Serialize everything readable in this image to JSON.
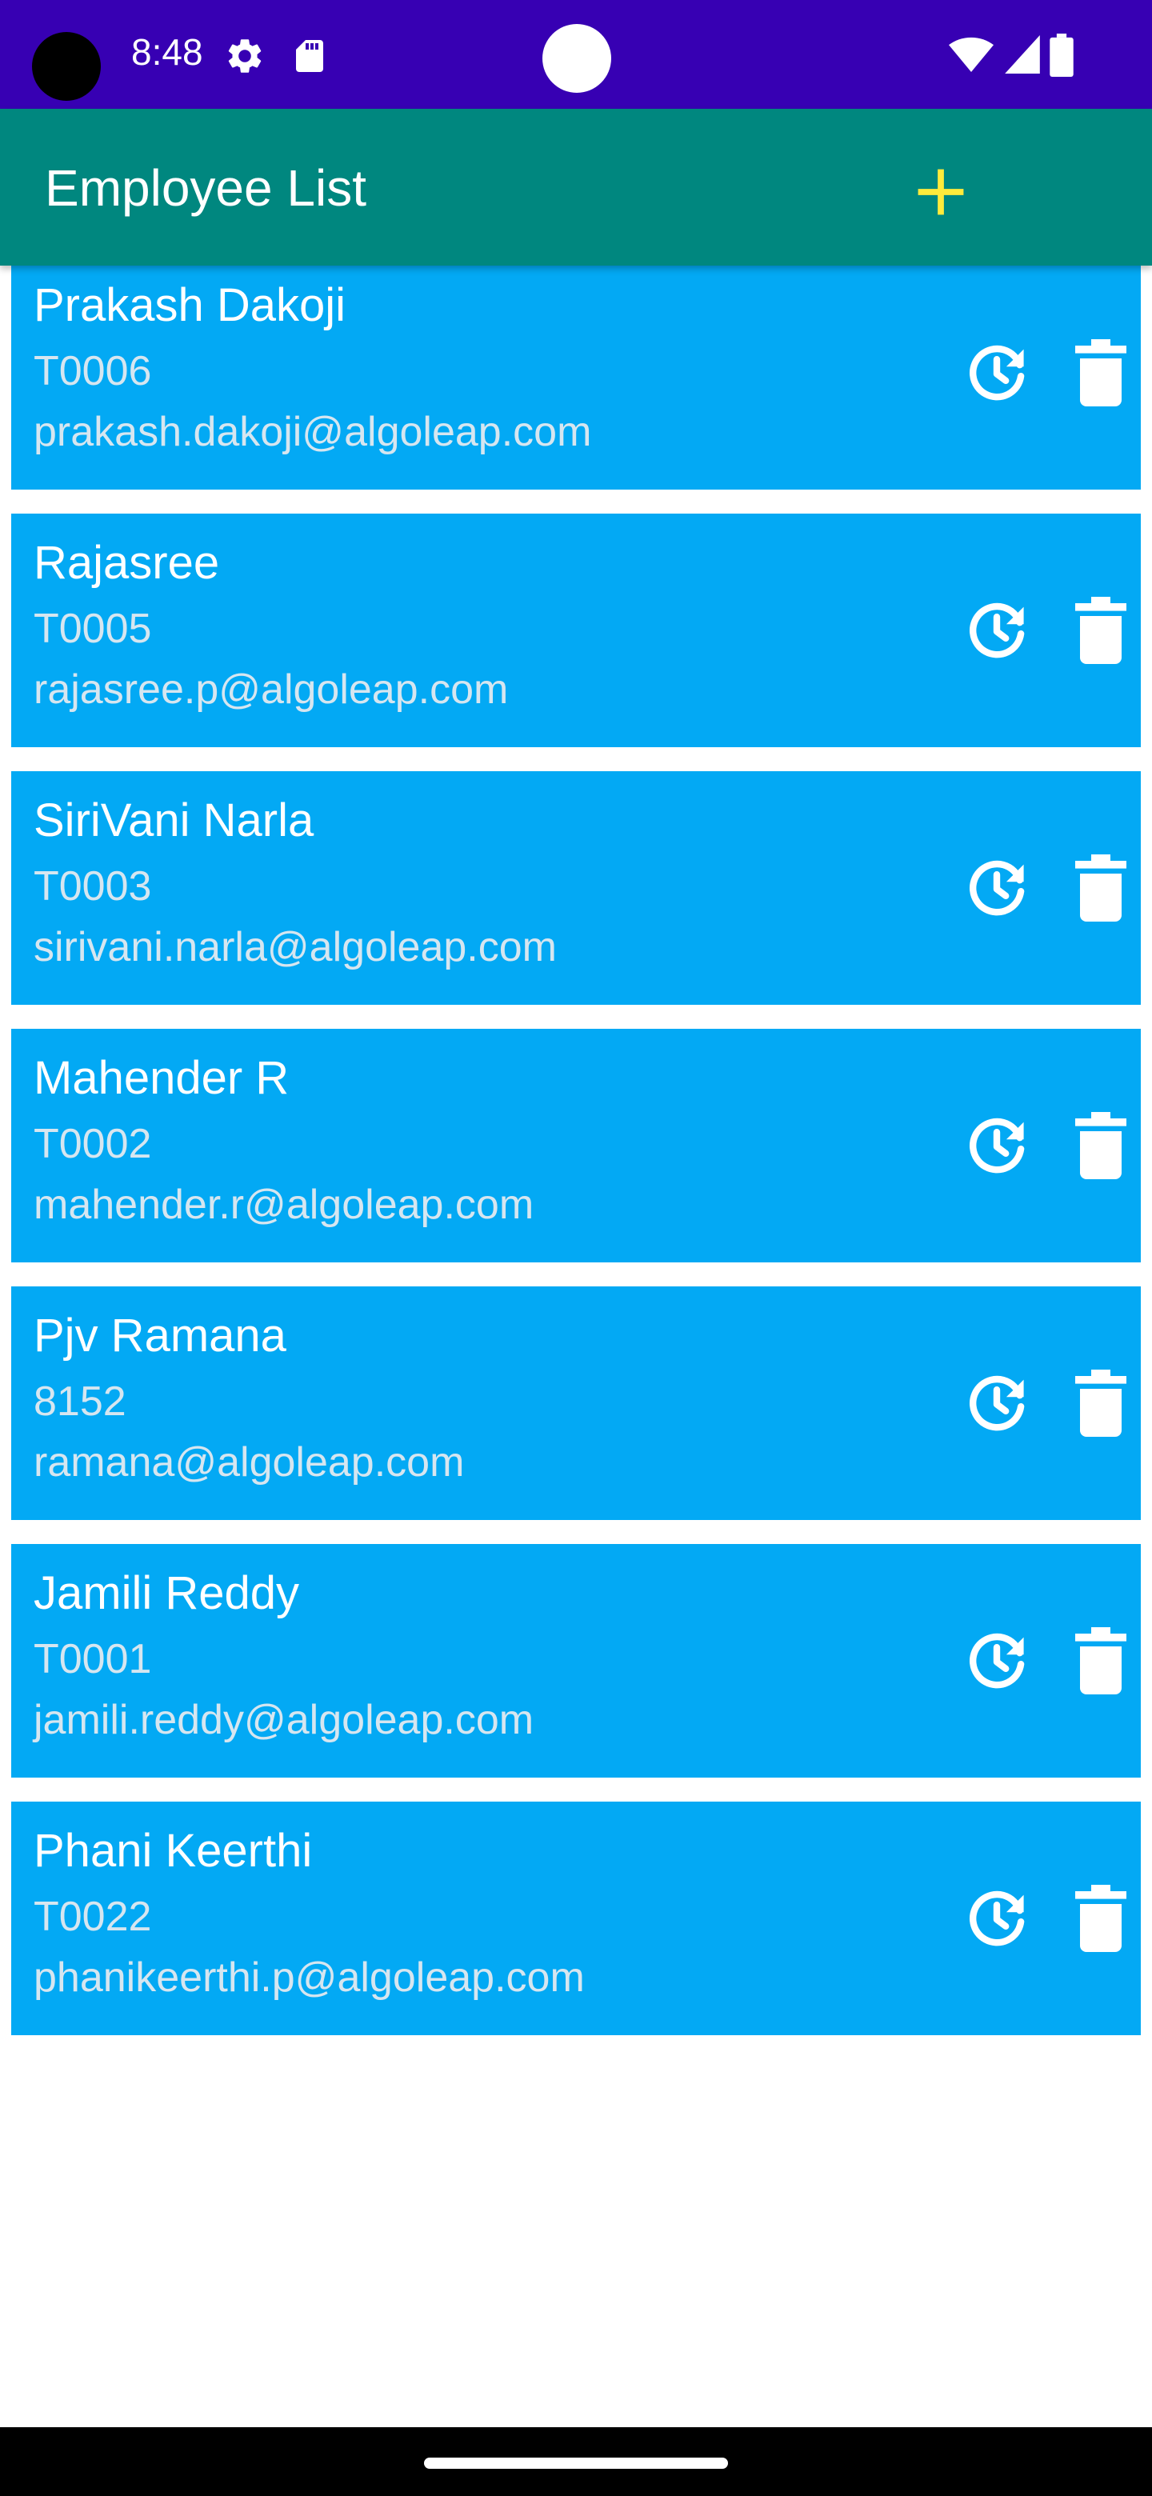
{
  "status_bar": {
    "time": "8:48",
    "icons": [
      "gear-icon",
      "sd-card-icon",
      "wifi-icon",
      "signal-icon",
      "battery-icon"
    ]
  },
  "app_bar": {
    "title": "Employee List",
    "add_icon": "plus-icon",
    "add_icon_color": "#ffeb3b"
  },
  "colors": {
    "status_bar": "#3700b3",
    "app_bar": "#00877f",
    "card": "#03a9f4",
    "secondary_text": "#d6e6f0"
  },
  "employees": [
    {
      "name": "Prakash Dakoji",
      "id": "T0006",
      "email": "prakash.dakoji@algoleap.com"
    },
    {
      "name": "Rajasree",
      "id": "T0005",
      "email": "rajasree.p@algoleap.com"
    },
    {
      "name": "SiriVani Narla",
      "id": "T0003",
      "email": "sirivani.narla@algoleap.com"
    },
    {
      "name": "Mahender R",
      "id": "T0002",
      "email": "mahender.r@algoleap.com"
    },
    {
      "name": "Pjv Ramana",
      "id": "8152",
      "email": "ramana@algoleap.com"
    },
    {
      "name": "Jamili Reddy",
      "id": "T0001",
      "email": "jamili.reddy@algoleap.com"
    },
    {
      "name": "Phani Keerthi",
      "id": "T0022",
      "email": "phanikeerthi.p@algoleap.com"
    }
  ],
  "row_icons": {
    "history": "history-icon",
    "delete": "trash-icon"
  }
}
